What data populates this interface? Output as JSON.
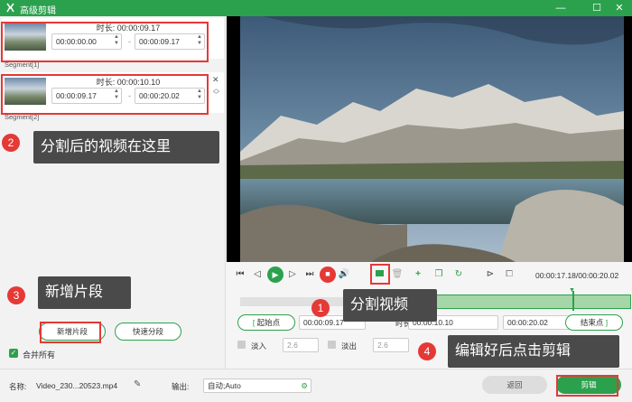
{
  "window": {
    "title": "高级剪辑",
    "controls": [
      "minimize-icon",
      "maximize-icon",
      "close-icon"
    ]
  },
  "segments": [
    {
      "duration_label": "时长: 00:00:09.17",
      "start": "00:00:00.00",
      "end": "00:00:09.17",
      "separator": "-",
      "label": "Segment[1]"
    },
    {
      "duration_label": "时长: 00:00:10.10",
      "start": "00:00:09.17",
      "end": "00:00:20.02",
      "separator": "-",
      "label": "Segment[2]"
    }
  ],
  "left": {
    "add_segment": "新增片段",
    "quick_split": "快速分段",
    "merge_all": "合并所有"
  },
  "callouts": {
    "c1": {
      "num": "1",
      "text": "分割视频"
    },
    "c2": {
      "num": "2",
      "text": "分割后的视频在这里"
    },
    "c3": {
      "num": "3",
      "text": "新增片段"
    },
    "c4": {
      "num": "4",
      "text": "编辑好后点击剪辑"
    }
  },
  "player": {
    "time": "00:00:17.18/00:00:20.02"
  },
  "range": {
    "start_btn": "起始点",
    "start_val": "00:00:09.17",
    "duration_label": "时长:",
    "duration_val": "00:00:10.10",
    "end_val": "00:00:20.02",
    "end_btn": "结束点",
    "fade_in_label": "淡入",
    "fade_in_val": "2.6",
    "fade_out_label": "淡出",
    "fade_out_val": "2.6"
  },
  "bottom": {
    "name_label": "名称:",
    "name_value": "Video_230...20523.mp4",
    "output_label": "输出:",
    "output_value": "自动;Auto",
    "back": "返回",
    "cut": "剪辑"
  },
  "colors": {
    "brand": "#2ca14d",
    "highlight": "#e53935",
    "callout_bg": "#4a4a4a"
  }
}
